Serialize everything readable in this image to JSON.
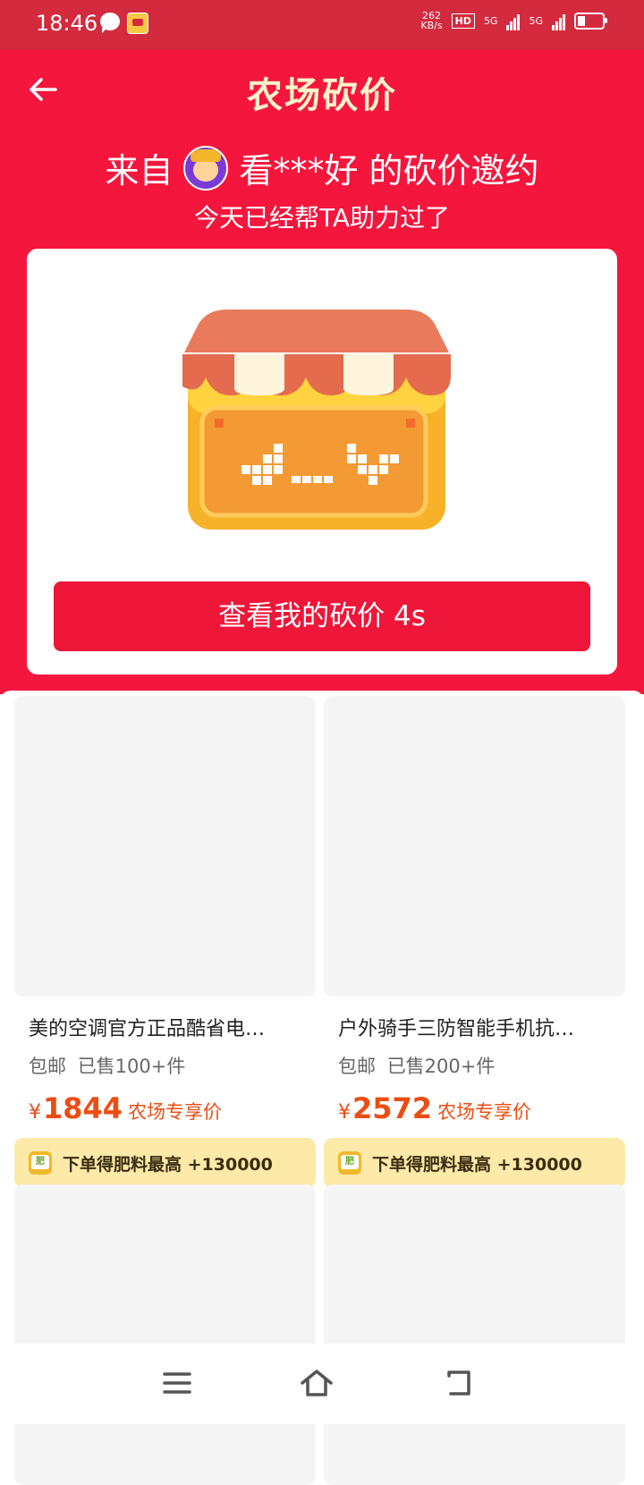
{
  "status_bar": {
    "time": "18:46",
    "speed_value": "262",
    "speed_unit": "KB/s",
    "hd_label": "HD",
    "sim1_net": "5G",
    "sim2_net": "5G",
    "icons": [
      "chat-icon",
      "app-notification-icon",
      "signal-icon",
      "battery-icon"
    ]
  },
  "header": {
    "title": "农场砍价",
    "back_icon": "arrow-left-icon"
  },
  "invite": {
    "prefix": "来自",
    "user_name": "看***好",
    "suffix": "的砍价邀约",
    "status_text": "今天已经帮TA助力过了"
  },
  "card": {
    "illustration": "shop-icon",
    "cta_label": "查看我的砍价 4s"
  },
  "products": [
    {
      "name": "美的空调官方正品酷省电…",
      "shipping": "包邮",
      "sold": "已售100+件",
      "currency": "¥",
      "price": "1844",
      "price_label": "农场专享价",
      "promo": "下单得肥料最高 +130000"
    },
    {
      "name": "户外骑手三防智能手机抗…",
      "shipping": "包邮",
      "sold": "已售200+件",
      "currency": "¥",
      "price": "2572",
      "price_label": "农场专享价",
      "promo": "下单得肥料最高 +130000"
    }
  ],
  "nav": {
    "icons": [
      "menu-icon",
      "home-icon",
      "back-icon"
    ]
  },
  "colors": {
    "status_bar": "#d42a3e",
    "hero": "#f5163d",
    "cta": "#ee1639",
    "price": "#ee4d12",
    "promo_bg": "#fde9a8",
    "title_text": "#fff3c9"
  }
}
